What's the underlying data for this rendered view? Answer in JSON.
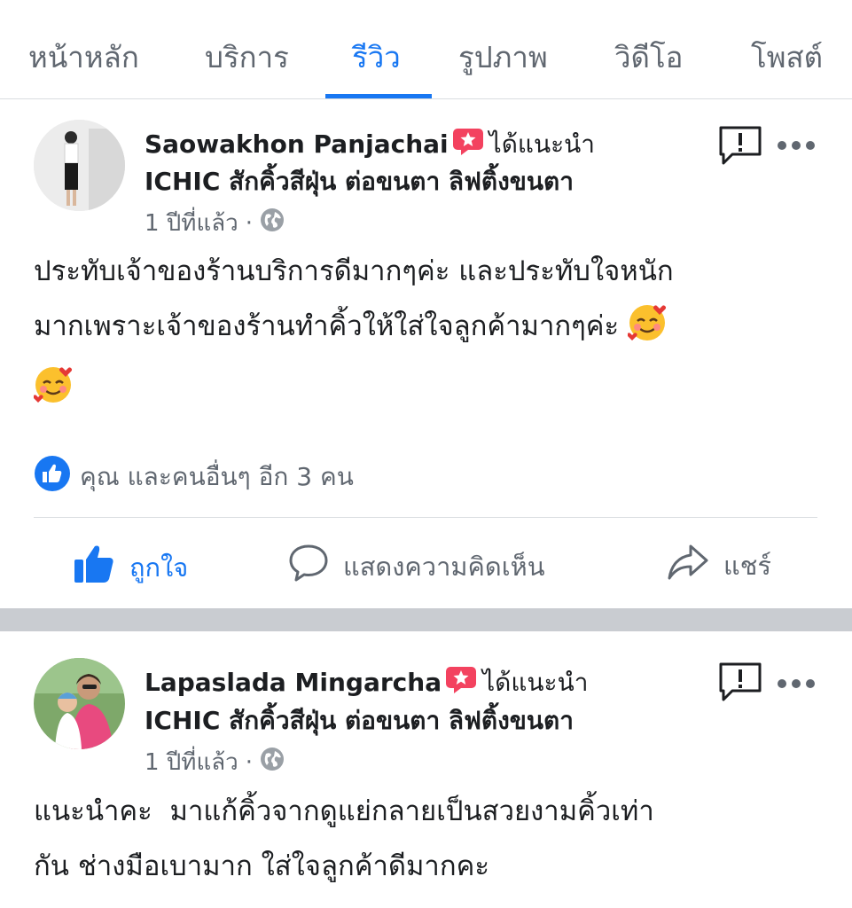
{
  "tabs": [
    {
      "label": "หน้าหลัก"
    },
    {
      "label": "บริการ"
    },
    {
      "label": "รีวิว",
      "active": true
    },
    {
      "label": "รูปภาพ"
    },
    {
      "label": "วิดีโอ"
    },
    {
      "label": "โพสต์"
    }
  ],
  "reviews": [
    {
      "name": "Saowakhon Panjachai",
      "recommend_text": "ได้แนะนำ",
      "page_name": "ICHIC สักคิ้วสีฝุ่น ต่อขนตา ลิฟติ้งขนตา",
      "time": "1 ปีที่แล้ว",
      "privacy_icon": "globe-icon",
      "text_line1": "ประทับเจ้าของร้านบริการดีมากๆค่ะ และประทับใจหนัก",
      "text_line2": "มากเพราะเจ้าของร้านทำคิ้วให้ใส่ใจลูกค้ามากๆค่ะ",
      "emoji": "smiling-face-with-hearts",
      "reactions": "คุณ และคนอื่นๆ อีก 3 คน",
      "actions": {
        "like": "ถูกใจ",
        "comment": "แสดงความคิดเห็น",
        "share": "แชร์"
      }
    },
    {
      "name": "Lapaslada Mingarcha",
      "recommend_text": "ได้แนะนำ",
      "page_name": "ICHIC สักคิ้วสีฝุ่น ต่อขนตา ลิฟติ้งขนตา",
      "time": "1 ปีที่แล้ว",
      "privacy_icon": "globe-icon",
      "text_line1": "แนะนำคะ  มาแก้คิ้วจากดูแย่กลายเป็นสวยงามคิ้วเท่า",
      "text_line2": "กัน ช่างมือเบามาก ใส่ใจลูกค้าดีมากคะ"
    }
  ],
  "colors": {
    "accent": "#1877f2",
    "recommend_badge": "#f3425f",
    "muted_text": "#606770",
    "separator": "#c9ccd1"
  }
}
